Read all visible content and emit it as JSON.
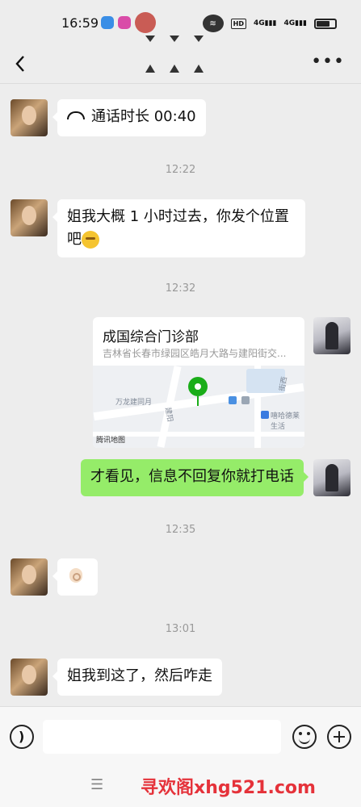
{
  "status_bar": {
    "time": "16:59",
    "hd": "HD",
    "signal1": "4G",
    "signal2": "4G"
  },
  "nav": {
    "back_icon": "chevron-left-icon",
    "more_icon": "more-horizontal-icon"
  },
  "messages": {
    "call": {
      "icon": "phone-icon",
      "text": "通话时长 00:40"
    },
    "ts1": "12:22",
    "msg1_line1": "姐我大概 1 小时过去，你发个位置",
    "msg1_line2": "吧",
    "ts2": "12:32",
    "location": {
      "title": "成国综合门诊部",
      "address": "吉林省长春市绿园区皓月大路与建阳街交...",
      "labels": [
        "万龙建同月",
        "建阳",
        "街西",
        "嘻哈德莱生活"
      ],
      "provider": "腾讯地图"
    },
    "msg2": "才看见，信息不回复你就打电话",
    "ts3": "12:35",
    "ts4": "13:01",
    "msg3": "姐我到这了，然后咋走"
  },
  "input_bar": {
    "value": "",
    "placeholder": ""
  },
  "watermark": "寻欢阁xhg521.com",
  "colors": {
    "bubble_green": "#95ec69",
    "background": "#ededed",
    "watermark_red": "#e5323a",
    "pin_green": "#1aad19"
  }
}
